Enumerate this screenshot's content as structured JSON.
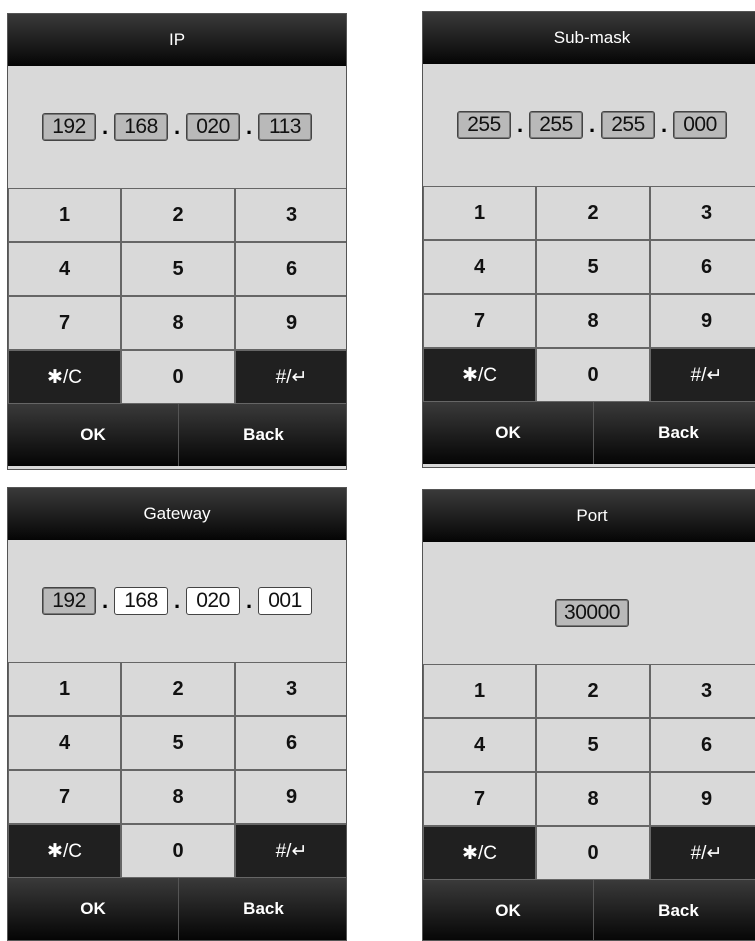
{
  "panels": {
    "ip": {
      "title": "IP",
      "fields": [
        "192",
        "168",
        "020",
        "113"
      ],
      "separator": "."
    },
    "submask": {
      "title": "Sub-mask",
      "fields": [
        "255",
        "255",
        "255",
        "000"
      ],
      "separator": "."
    },
    "gateway": {
      "title": "Gateway",
      "fields": [
        "192",
        "168",
        "020",
        "001"
      ],
      "separator": "."
    },
    "port": {
      "title": "Port",
      "fields": [
        "30000"
      ]
    }
  },
  "keypad": {
    "keys": [
      "1",
      "2",
      "3",
      "4",
      "5",
      "6",
      "7",
      "8",
      "9",
      "✱/C",
      "0",
      "#/↵"
    ]
  },
  "buttons": {
    "ok": "OK",
    "back": "Back"
  }
}
